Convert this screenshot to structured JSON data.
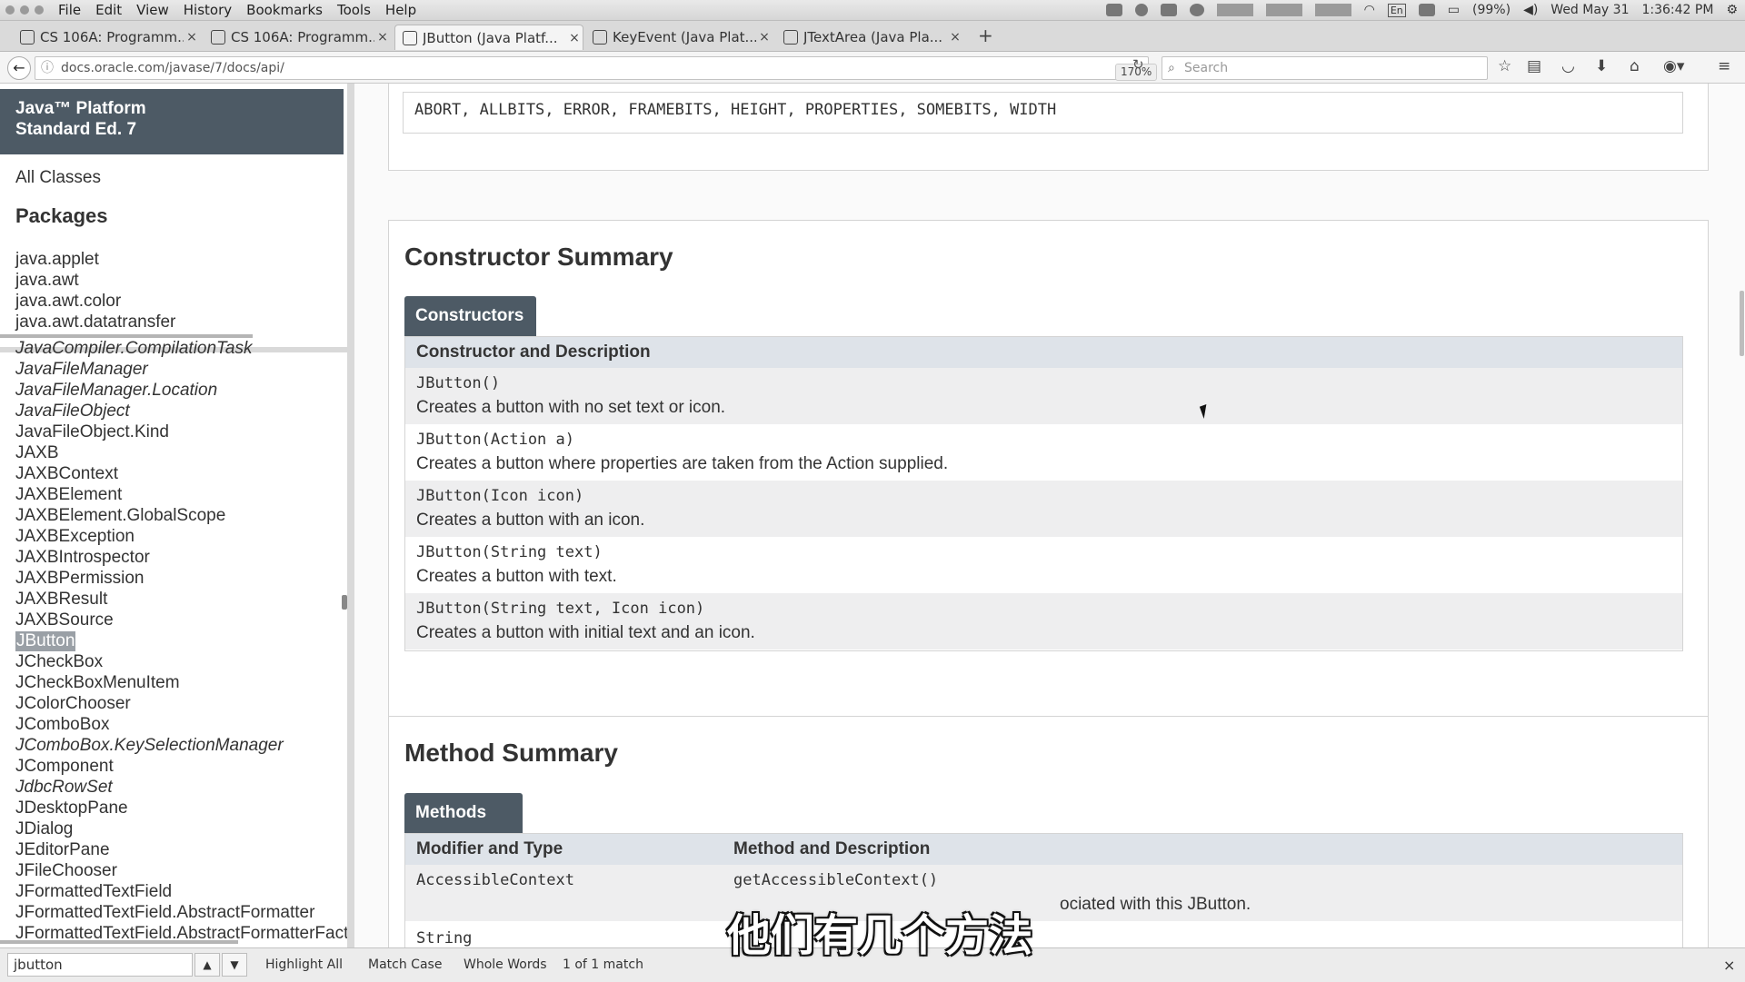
{
  "menubar": {
    "items": [
      "File",
      "Edit",
      "View",
      "History",
      "Bookmarks",
      "Tools",
      "Help"
    ],
    "tray": {
      "battery": "(99%)",
      "datetime": "Wed May 31",
      "time": "1:36:42 PM",
      "lang": "En"
    }
  },
  "tabs": [
    {
      "label": "CS 106A: Programm...",
      "icon": "s-favicon-icon"
    },
    {
      "label": "CS 106A: Programm...",
      "icon": "s-favicon-icon"
    },
    {
      "label": "JButton (Java Platf...",
      "icon": "page-favicon-icon"
    },
    {
      "label": "KeyEvent (Java Plat...",
      "icon": "page-favicon-icon"
    },
    {
      "label": "JTextArea (Java Pla...",
      "icon": "page-favicon-icon"
    }
  ],
  "navbar": {
    "url": "docs.oracle.com/javase/7/docs/api/",
    "zoom": "170%",
    "search_placeholder": "Search"
  },
  "leftpane": {
    "header_line1": "Java™ Platform",
    "header_line2": "Standard Ed. 7",
    "all_classes": "All Classes",
    "packages_title": "Packages",
    "packages": [
      "java.applet",
      "java.awt",
      "java.awt.color",
      "java.awt.datatransfer"
    ],
    "classes": [
      {
        "name": "JavaCompiler.CompilationTask",
        "italic": true
      },
      {
        "name": "JavaFileManager",
        "italic": true
      },
      {
        "name": "JavaFileManager.Location",
        "italic": true
      },
      {
        "name": "JavaFileObject",
        "italic": true
      },
      {
        "name": "JavaFileObject.Kind",
        "italic": false
      },
      {
        "name": "JAXB",
        "italic": false
      },
      {
        "name": "JAXBContext",
        "italic": false
      },
      {
        "name": "JAXBElement",
        "italic": false
      },
      {
        "name": "JAXBElement.GlobalScope",
        "italic": false
      },
      {
        "name": "JAXBException",
        "italic": false
      },
      {
        "name": "JAXBIntrospector",
        "italic": false
      },
      {
        "name": "JAXBPermission",
        "italic": false
      },
      {
        "name": "JAXBResult",
        "italic": false
      },
      {
        "name": "JAXBSource",
        "italic": false
      },
      {
        "name": "JButton",
        "italic": false,
        "selected": true
      },
      {
        "name": "JCheckBox",
        "italic": false
      },
      {
        "name": "JCheckBoxMenuItem",
        "italic": false
      },
      {
        "name": "JColorChooser",
        "italic": false
      },
      {
        "name": "JComboBox",
        "italic": false
      },
      {
        "name": "JComboBox.KeySelectionManager",
        "italic": true
      },
      {
        "name": "JComponent",
        "italic": false
      },
      {
        "name": "JdbcRowSet",
        "italic": true
      },
      {
        "name": "JDesktopPane",
        "italic": false
      },
      {
        "name": "JDialog",
        "italic": false
      },
      {
        "name": "JEditorPane",
        "italic": false
      },
      {
        "name": "JFileChooser",
        "italic": false
      },
      {
        "name": "JFormattedTextField",
        "italic": false
      },
      {
        "name": "JFormattedTextField.AbstractFormatter",
        "italic": false
      },
      {
        "name": "JFormattedTextField.AbstractFormatterFactory",
        "italic": false
      }
    ]
  },
  "fields": {
    "inherited": "ABORT, ALLBITS, ERROR, FRAMEBITS, HEIGHT, PROPERTIES, SOMEBITS, WIDTH"
  },
  "constructors": {
    "title": "Constructor Summary",
    "caption": "Constructors",
    "header": "Constructor and Description",
    "rows": [
      {
        "sig": "JButton()",
        "desc": "Creates a button with no set text or icon."
      },
      {
        "sig": "JButton(Action a)",
        "desc": "Creates a button where properties are taken from the Action supplied."
      },
      {
        "sig": "JButton(Icon icon)",
        "desc": "Creates a button with an icon."
      },
      {
        "sig": "JButton(String text)",
        "desc": "Creates a button with text."
      },
      {
        "sig": "JButton(String text, Icon icon)",
        "desc": "Creates a button with initial text and an icon."
      }
    ]
  },
  "methods": {
    "title": "Method Summary",
    "caption": "Methods",
    "header_col1": "Modifier and Type",
    "header_col2": "Method and Description",
    "rows": [
      {
        "type": "AccessibleContext",
        "sig": "getAccessibleContext()",
        "desc": "ociated with this JButton."
      },
      {
        "type": "String",
        "sig": "",
        "desc": ""
      }
    ]
  },
  "findbar": {
    "query": "jbutton",
    "highlight_all": "Highlight All",
    "match_case": "Match Case",
    "whole_words": "Whole Words",
    "status": "1 of 1 match"
  },
  "subtitle": "他们有几个方法"
}
